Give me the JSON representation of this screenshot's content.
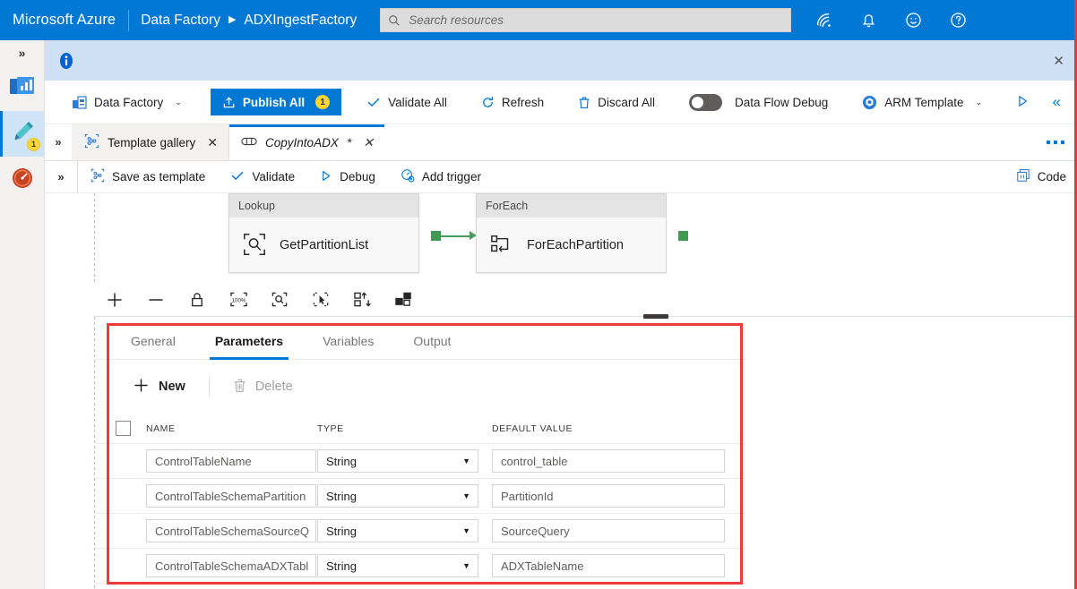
{
  "topbar": {
    "brand": "Microsoft Azure",
    "service": "Data Factory",
    "caret": "▶",
    "resource": "ADXIngestFactory",
    "search_placeholder": "Search resources",
    "icons": [
      "cloud-shell-icon",
      "notifications-bell-icon",
      "feedback-smiley-icon",
      "help-question-icon"
    ]
  },
  "rail": {
    "expand_chevron": "»",
    "items": [
      {
        "name": "home-monitor-icon",
        "badge": ""
      },
      {
        "name": "author-pencil-icon",
        "badge": "1"
      },
      {
        "name": "monitor-gauge-icon",
        "badge": ""
      }
    ]
  },
  "info_banner": {
    "icon": "info-icon",
    "message": "",
    "close": "✕"
  },
  "commandbar": {
    "factory_label": "Data Factory",
    "factory_caret": "⌄",
    "publish_label": "Publish All",
    "publish_count": "1",
    "validate_all_label": "Validate All",
    "refresh_label": "Refresh",
    "discard_all_label": "Discard All",
    "data_flow_debug_label": "Data Flow Debug",
    "data_flow_debug_on": false,
    "arm_template_label": "ARM Template",
    "arm_caret": "⌄",
    "collapse_label": "«"
  },
  "tabstrip": {
    "chevron": "»",
    "tabs": [
      {
        "label": "Template gallery",
        "icon": "template-gallery-icon",
        "active": false,
        "dirty": ""
      },
      {
        "label": "CopyIntoADX",
        "icon": "pipeline-icon",
        "active": true,
        "dirty": "*"
      }
    ],
    "overflow": "more-options-ellipsis"
  },
  "pipeline_toolbar": {
    "chevron": "»",
    "items": [
      {
        "label": "Save as template",
        "icon": "save-template-icon"
      },
      {
        "label": "Validate",
        "icon": "check-icon"
      },
      {
        "label": "Debug",
        "icon": "play-triangle-icon"
      },
      {
        "label": "Add trigger",
        "icon": "add-trigger-icon"
      }
    ],
    "code_label": "Code",
    "code_icon": "code-braces-icon"
  },
  "canvas": {
    "activities": [
      {
        "type": "Lookup",
        "name": "GetPartitionList",
        "icon": "lookup-magnifier-icon"
      },
      {
        "type": "ForEach",
        "name": "ForEachPartition",
        "icon": "foreach-loop-icon"
      }
    ],
    "connector_color": "#4a9c5d",
    "zoom_tools": [
      "zoom-in-icon",
      "zoom-out-icon",
      "lock-icon",
      "zoom-to-100-icon",
      "zoom-to-fit-icon",
      "select-mode-icon",
      "auto-align-icon",
      "show-related-icon"
    ]
  },
  "panel": {
    "tabs": [
      {
        "label": "General",
        "selected": false
      },
      {
        "label": "Parameters",
        "selected": true
      },
      {
        "label": "Variables",
        "selected": false
      },
      {
        "label": "Output",
        "selected": false
      }
    ],
    "toolbar": {
      "new_label": "New",
      "new_icon": "plus-icon",
      "delete_label": "Delete",
      "delete_icon": "trash-icon",
      "delete_disabled": true
    },
    "columns": [
      "NAME",
      "TYPE",
      "DEFAULT VALUE"
    ],
    "rows": [
      {
        "name": "ControlTableName",
        "type": "String",
        "default": "control_table"
      },
      {
        "name": "ControlTableSchemaPartition",
        "type": "String",
        "default": "PartitionId"
      },
      {
        "name": "ControlTableSchemaSourceQ",
        "type": "String",
        "default": "SourceQuery"
      },
      {
        "name": "ControlTableSchemaADXTabl",
        "type": "String",
        "default": "ADXTableName"
      }
    ],
    "type_caret": "▼",
    "highlight_color": "#ed3b3b"
  }
}
